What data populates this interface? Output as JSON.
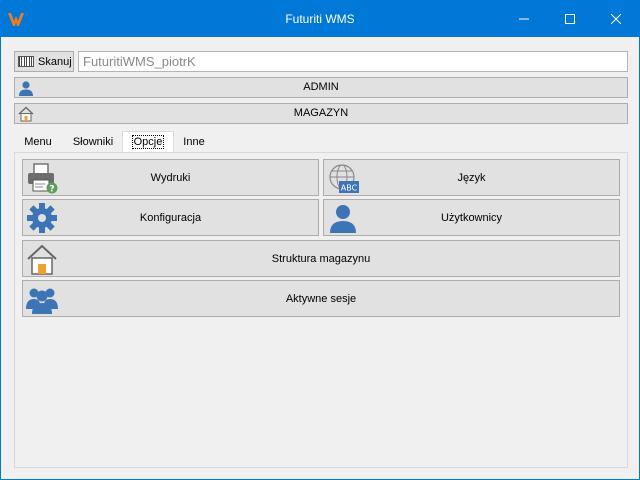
{
  "window": {
    "title": "Futuriti WMS",
    "accent": "#0078d7"
  },
  "scan": {
    "button_label": "Skanuj",
    "input_value": "FuturitiWMS_piotrK"
  },
  "user_bar": {
    "label": "ADMIN",
    "icon": "user-icon"
  },
  "warehouse_bar": {
    "label": "MAGAZYN",
    "icon": "home-icon"
  },
  "tabs": [
    {
      "label": "Menu",
      "active": false
    },
    {
      "label": "Słowniki",
      "active": false
    },
    {
      "label": "Opcje",
      "active": true
    },
    {
      "label": "Inne",
      "active": false
    }
  ],
  "options": {
    "prints": {
      "label": "Wydruki",
      "icon": "printer-icon"
    },
    "language": {
      "label": "Język",
      "icon": "globe-abc-icon"
    },
    "configuration": {
      "label": "Konfiguracja",
      "icon": "gear-icon"
    },
    "users": {
      "label": "Użytkownicy",
      "icon": "user-icon"
    },
    "warehouse_structure": {
      "label": "Struktura magazynu",
      "icon": "house-icon"
    },
    "active_sessions": {
      "label": "Aktywne sesje",
      "icon": "users-group-icon"
    }
  }
}
